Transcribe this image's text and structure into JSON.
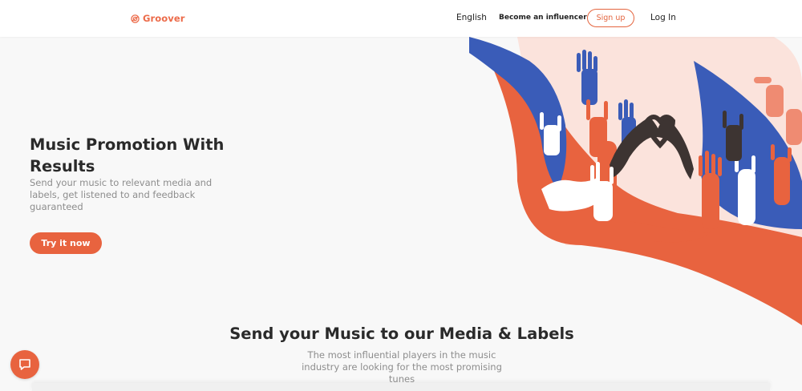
{
  "header": {
    "logo_text": "Groover",
    "nav_language": "English",
    "nav_influencer": "Become an influencer",
    "nav_signup": "Sign up",
    "nav_login": "Log In"
  },
  "hero": {
    "title": "Music Promotion With Results",
    "subtitle": "Send your music to relevant media and labels, get listened to and feedback guaranteed",
    "cta_label": "Try it now",
    "illustration": "crowd-raised-hands-heart"
  },
  "section": {
    "title": "Send your Music to our Media & Labels",
    "subtitle": "The most influential players in the music industry are looking for the most promising tunes"
  },
  "chat": {
    "icon": "chat-bubble-icon"
  },
  "colors": {
    "brand": "#e8633f",
    "blue": "#3a5cb8",
    "dark": "#3d3432",
    "pink_bg": "#fbe0d8",
    "page_bg": "#f8f8f8"
  }
}
